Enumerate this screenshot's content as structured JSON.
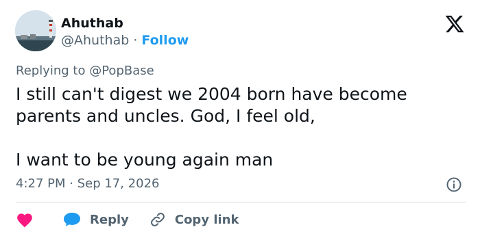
{
  "author": {
    "name": "Ahuthab",
    "handle": "@Ahuthab",
    "separator": "·",
    "follow_label": "Follow"
  },
  "replying": {
    "prefix": "Replying to",
    "handle": "@PopBase"
  },
  "tweet": {
    "text": "I still can't digest we 2004 born have become\nparents and uncles. God, I feel old,\n\nI want to be young again man",
    "timestamp": "4:27 PM · Sep 17, 2026"
  },
  "actions": {
    "reply_label": "Reply",
    "copy_link_label": "Copy link"
  },
  "icons": {
    "logo": "x-logo-icon",
    "info": "info-icon",
    "like": "heart-icon",
    "reply": "reply-bubble-icon",
    "copy": "link-icon"
  },
  "colors": {
    "accent": "#1d9bf0",
    "like": "#f91880",
    "text": "#0f1419",
    "secondary": "#536471",
    "divider": "#cfd9de"
  }
}
